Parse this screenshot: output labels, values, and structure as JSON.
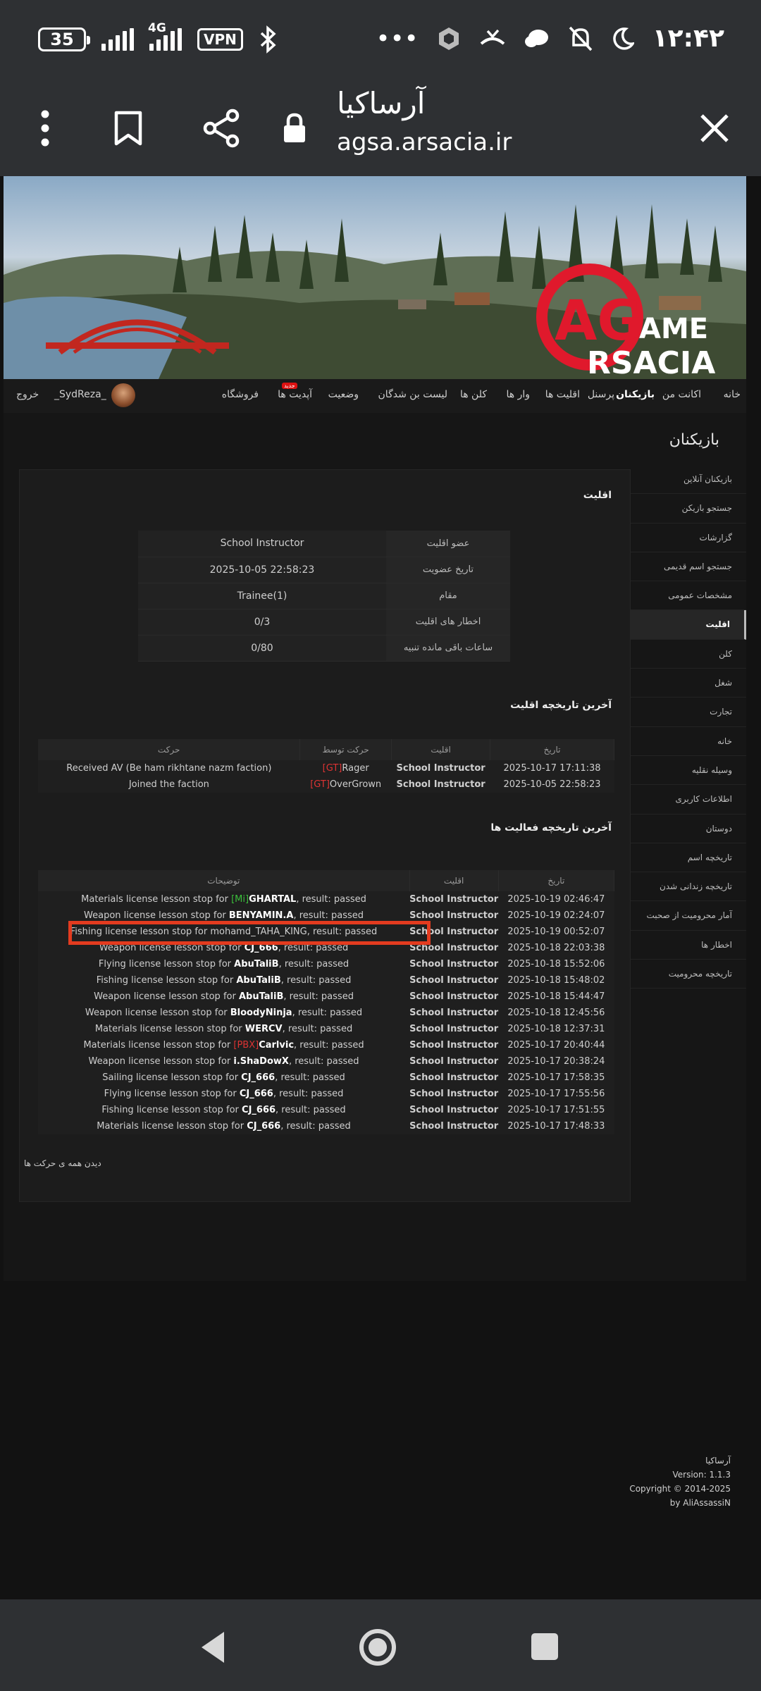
{
  "status_bar": {
    "battery": "35",
    "network": "4G",
    "vpn": "VPN",
    "overflow": "•••",
    "clock": "۱۲:۴۲"
  },
  "browser": {
    "title": "آرساکیا",
    "url": "agsa.arsacia.ir"
  },
  "banner": {
    "logo_line1": "AME",
    "logo_line2": "RSACIA",
    "logo_mark": "AG"
  },
  "nav": {
    "items": [
      "خانه",
      "اکانت من",
      "بازیکنان",
      "پرسنل",
      "اقلیت ها",
      "وار ها",
      "کلن ها",
      "لیست بن شدگان",
      "وضعیت",
      "آپدیت ها",
      "فروشگاه"
    ],
    "new_badge": "جدید",
    "username": "_SydReza_",
    "logout": "خروج"
  },
  "page_heading": "بازیکنان",
  "sidebar": {
    "items": [
      "بازیکنان آنلاین",
      "جستجو بازیکن",
      "گزارشات",
      "جستجو اسم قدیمی",
      "مشخصات عمومی",
      "اقلیت",
      "کلن",
      "شغل",
      "تجارت",
      "خانه",
      "وسیله نقلیه",
      "اطلاعات کاربری",
      "دوستان",
      "تاریخچه اسم",
      "تاریخچه زندانی شدن",
      "آمار محرومیت از صحبت",
      "اخطار ها",
      "تاریخچه محرومیت"
    ]
  },
  "faction": {
    "title": "اقلیت",
    "rows": [
      {
        "key": "عضو اقلیت",
        "value": "School Instructor"
      },
      {
        "key": "تاریخ عضویت",
        "value": "2025-10-05 22:58:23"
      },
      {
        "key": "مقام",
        "value": "Trainee(1)"
      },
      {
        "key": "اخطار های اقلیت",
        "value": "0/3"
      },
      {
        "key": "ساعات باقی مانده تنبیه",
        "value": "0/80"
      }
    ]
  },
  "faction_history": {
    "title": "آخرین تاریخچه اقلیت",
    "headers": {
      "date": "تاریخ",
      "faction": "اقلیت",
      "by": "حرکت توسط",
      "action": "حرکت"
    },
    "rows": [
      {
        "date": "2025-10-17 17:11:38",
        "faction": "School Instructor",
        "by_tag": "[GT]",
        "by_name": "Rager",
        "action": "Received AV (Be ham rikhtane nazm faction)"
      },
      {
        "date": "2025-10-05 22:58:23",
        "faction": "School Instructor",
        "by_tag": "[GT]",
        "by_name": "OverGrown",
        "action": "Joined the faction"
      }
    ]
  },
  "activity_history": {
    "title": "آخرین تاریخچه فعالیت ها",
    "headers": {
      "date": "تاریخ",
      "faction": "اقلیت",
      "desc": "توضیحات"
    },
    "result_text": ", result: passed",
    "rows": [
      {
        "date": "2025-10-19 02:46:47",
        "faction": "School Instructor",
        "prefix": "Materials license lesson stop for ",
        "tag": "[Mi]",
        "tag_color": "green",
        "name": "GHARTAL"
      },
      {
        "date": "2025-10-19 02:24:07",
        "faction": "School Instructor",
        "prefix": "Weapon license lesson stop for ",
        "tag": "",
        "tag_color": "",
        "name": "BENYAMIN.A"
      },
      {
        "date": "2025-10-19 00:52:07",
        "faction": "School Instructor",
        "prefix": "Fishing license lesson stop for ",
        "tag": "",
        "tag_color": "",
        "name": "mohamd_TAHA_KING",
        "plain": true
      },
      {
        "date": "2025-10-18 22:03:38",
        "faction": "School Instructor",
        "prefix": "Weapon license lesson stop for ",
        "tag": "",
        "tag_color": "",
        "name": "CJ_666"
      },
      {
        "date": "2025-10-18 15:52:06",
        "faction": "School Instructor",
        "prefix": "Flying license lesson stop for ",
        "tag": "",
        "tag_color": "",
        "name": "AbuTaliB"
      },
      {
        "date": "2025-10-18 15:48:02",
        "faction": "School Instructor",
        "prefix": "Fishing license lesson stop for ",
        "tag": "",
        "tag_color": "",
        "name": "AbuTaliB"
      },
      {
        "date": "2025-10-18 15:44:47",
        "faction": "School Instructor",
        "prefix": "Weapon license lesson stop for ",
        "tag": "",
        "tag_color": "",
        "name": "AbuTaliB"
      },
      {
        "date": "2025-10-18 12:45:56",
        "faction": "School Instructor",
        "prefix": "Weapon license lesson stop for ",
        "tag": "",
        "tag_color": "",
        "name": "BloodyNinja"
      },
      {
        "date": "2025-10-18 12:37:31",
        "faction": "School Instructor",
        "prefix": "Materials license lesson stop for ",
        "tag": "",
        "tag_color": "",
        "name": "WERCV"
      },
      {
        "date": "2025-10-17 20:40:44",
        "faction": "School Instructor",
        "prefix": "Materials license lesson stop for ",
        "tag": "[PBX]",
        "tag_color": "red",
        "name": "Carlvic"
      },
      {
        "date": "2025-10-17 20:38:24",
        "faction": "School Instructor",
        "prefix": "Weapon license lesson stop for ",
        "tag": "",
        "tag_color": "",
        "name": "i.ShaDowX"
      },
      {
        "date": "2025-10-17 17:58:35",
        "faction": "School Instructor",
        "prefix": "Sailing license lesson stop for ",
        "tag": "",
        "tag_color": "",
        "name": "CJ_666"
      },
      {
        "date": "2025-10-17 17:55:56",
        "faction": "School Instructor",
        "prefix": "Flying license lesson stop for ",
        "tag": "",
        "tag_color": "",
        "name": "CJ_666"
      },
      {
        "date": "2025-10-17 17:51:55",
        "faction": "School Instructor",
        "prefix": "Fishing license lesson stop for ",
        "tag": "",
        "tag_color": "",
        "name": "CJ_666"
      },
      {
        "date": "2025-10-17 17:48:33",
        "faction": "School Instructor",
        "prefix": "Materials license lesson stop for ",
        "tag": "",
        "tag_color": "",
        "name": "CJ_666"
      }
    ],
    "see_all": "دیدن همه ی حرکت ها"
  },
  "footer": {
    "site": "آرساکیا",
    "version": "Version: 1.1.3",
    "copyright": "Copyright © 2014-2025",
    "author": "by AliAssassiN"
  },
  "colors": {
    "accent_blue": "#3d8bd9",
    "tag_red": "#dd3333",
    "tag_green": "#3bbf3b",
    "highlight": "#e33b1f",
    "logo_red": "#e0192c"
  }
}
